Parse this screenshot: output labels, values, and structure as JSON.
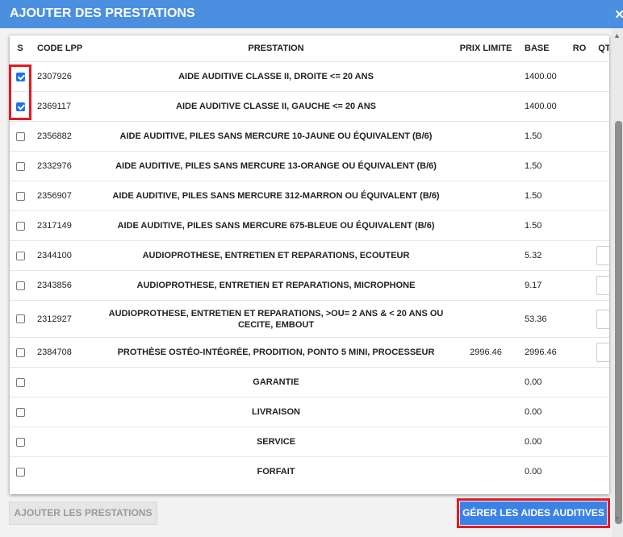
{
  "dialog": {
    "title": "AJOUTER DES PRESTATIONS",
    "close_icon": "close-icon"
  },
  "table": {
    "headers": {
      "s": "S",
      "code": "CODE LPP",
      "prestation": "PRESTATION",
      "prix": "PRIX LIMITE",
      "base": "BASE",
      "ro": "RO",
      "qte": "QTE"
    },
    "rows": [
      {
        "checked": true,
        "code": "2307926",
        "prestation": "AIDE AUDITIVE CLASSE II, DROITE <= 20 ANS",
        "prix": "",
        "base": "1400.00",
        "ro": "",
        "qte_input": false
      },
      {
        "checked": true,
        "code": "2369117",
        "prestation": "AIDE AUDITIVE CLASSE II, GAUCHE <= 20 ANS",
        "prix": "",
        "base": "1400.00",
        "ro": "",
        "qte_input": false
      },
      {
        "checked": false,
        "code": "2356882",
        "prestation": "AIDE AUDITIVE, PILES SANS MERCURE 10-JAUNE OU ÉQUIVALENT (B/6)",
        "prix": "",
        "base": "1.50",
        "ro": "",
        "qte_input": false
      },
      {
        "checked": false,
        "code": "2332976",
        "prestation": "AIDE AUDITIVE, PILES SANS MERCURE 13-ORANGE OU ÉQUIVALENT (B/6)",
        "prix": "",
        "base": "1.50",
        "ro": "",
        "qte_input": false
      },
      {
        "checked": false,
        "code": "2356907",
        "prestation": "AIDE AUDITIVE, PILES SANS MERCURE 312-MARRON OU ÉQUIVALENT (B/6)",
        "prix": "",
        "base": "1.50",
        "ro": "",
        "qte_input": false
      },
      {
        "checked": false,
        "code": "2317149",
        "prestation": "AIDE AUDITIVE, PILES SANS MERCURE 675-BLEUE OU ÉQUIVALENT (B/6)",
        "prix": "",
        "base": "1.50",
        "ro": "",
        "qte_input": false
      },
      {
        "checked": false,
        "code": "2344100",
        "prestation": "AUDIOPROTHESE, ENTRETIEN ET REPARATIONS, ECOUTEUR",
        "prix": "",
        "base": "5.32",
        "ro": "",
        "qte_input": true
      },
      {
        "checked": false,
        "code": "2343856",
        "prestation": "AUDIOPROTHESE, ENTRETIEN ET REPARATIONS, MICROPHONE",
        "prix": "",
        "base": "9.17",
        "ro": "",
        "qte_input": true
      },
      {
        "checked": false,
        "code": "2312927",
        "prestation": "AUDIOPROTHESE, ENTRETIEN ET REPARATIONS, >OU= 2 ANS & < 20 ANS OU CECITE, EMBOUT",
        "prix": "",
        "base": "53.36",
        "ro": "",
        "qte_input": true
      },
      {
        "checked": false,
        "code": "2384708",
        "prestation": "PROTHÈSE OSTÉO-INTÉGRÉE, PRODITION, PONTO 5 MINI, PROCESSEUR",
        "prix": "2996.46",
        "base": "2996.46",
        "ro": "",
        "qte_input": true
      },
      {
        "checked": false,
        "code": "",
        "prestation": "GARANTIE",
        "prix": "",
        "base": "0.00",
        "ro": "",
        "qte_input": false
      },
      {
        "checked": false,
        "code": "",
        "prestation": "LIVRAISON",
        "prix": "",
        "base": "0.00",
        "ro": "",
        "qte_input": false
      },
      {
        "checked": false,
        "code": "",
        "prestation": "SERVICE",
        "prix": "",
        "base": "0.00",
        "ro": "",
        "qte_input": false
      },
      {
        "checked": false,
        "code": "",
        "prestation": "FORFAIT",
        "prix": "",
        "base": "0.00",
        "ro": "",
        "qte_input": false
      }
    ]
  },
  "footer": {
    "add_label": "AJOUTER LES PRESTATIONS",
    "manage_label": "GÉRER LES AIDES AUDITIVES"
  },
  "colors": {
    "title_bar": "#4a8fe0",
    "primary_button": "#3b82e8",
    "highlight": "#e01b24",
    "checkbox": "#1a73e8"
  }
}
